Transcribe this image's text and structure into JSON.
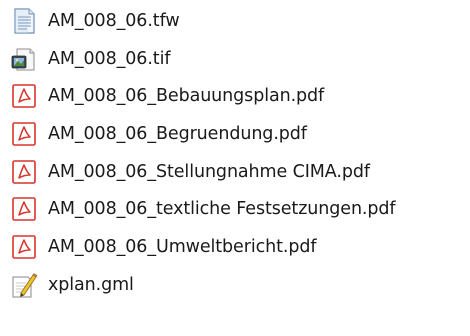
{
  "files": [
    {
      "name": "AM_008_06.tfw",
      "icon": "text-document-icon"
    },
    {
      "name": "AM_008_06.tif",
      "icon": "image-file-icon"
    },
    {
      "name": "AM_008_06_Bebauungsplan.pdf",
      "icon": "pdf-icon"
    },
    {
      "name": "AM_008_06_Begruendung.pdf",
      "icon": "pdf-icon"
    },
    {
      "name": "AM_008_06_Stellungnahme CIMA.pdf",
      "icon": "pdf-icon"
    },
    {
      "name": "AM_008_06_textliche Festsetzungen.pdf",
      "icon": "pdf-icon"
    },
    {
      "name": "AM_008_06_Umweltbericht.pdf",
      "icon": "pdf-icon"
    },
    {
      "name": "xplan.gml",
      "icon": "gml-edit-file-icon"
    }
  ],
  "colors": {
    "pdf_red": "#d9342b",
    "text": "#1a1a1a",
    "background": "#ffffff"
  }
}
